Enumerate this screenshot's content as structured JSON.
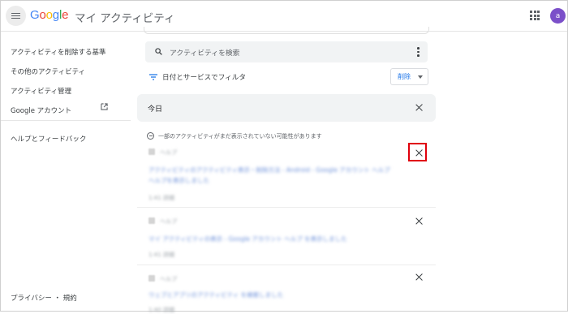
{
  "header": {
    "logo_letters": [
      "G",
      "o",
      "o",
      "g",
      "l",
      "e"
    ],
    "app_title": "マイ アクティビティ",
    "avatar_initial": "a",
    "avatar_color": "#7b4fc9"
  },
  "sidebar": {
    "items": [
      {
        "label": "アクティビティを削除する基準"
      },
      {
        "label": "その他のアクティビティ"
      },
      {
        "label": "アクティビティ管理"
      },
      {
        "label": "Google アカウント"
      },
      {
        "label": "ヘルプとフィードバック"
      }
    ],
    "footer": "プライバシー ・ 規約"
  },
  "search": {
    "placeholder": "アクティビティを検索"
  },
  "filter": {
    "label": "日付とサービスでフィルタ",
    "delete_button": "削除"
  },
  "today": {
    "label": "今日"
  },
  "notice": {
    "text": "一部のアクティビティがまだ表示されていない可能性があります"
  },
  "entries": [
    {
      "service": "ヘルプ",
      "link_line1": "アクティビティのアクティビティ表示・削除方法 - Android - Google アカウント ヘルプ",
      "link_line2": "ヘルプを表示しました",
      "time": "1:41 詳細"
    },
    {
      "service": "ヘルプ",
      "link_line1": "マイ アクティビティの表示 - Google アカウント ヘルプ を表示しました",
      "link_line2": "",
      "time": "1:41 詳細"
    },
    {
      "service": "ヘルプ",
      "link_line1": "ウェブとアプリのアクティビティ を検索しました",
      "link_line2": "",
      "time": "1:40 詳細"
    }
  ],
  "colors": {
    "accent": "#1a73e8",
    "highlight": "#e0000c"
  }
}
